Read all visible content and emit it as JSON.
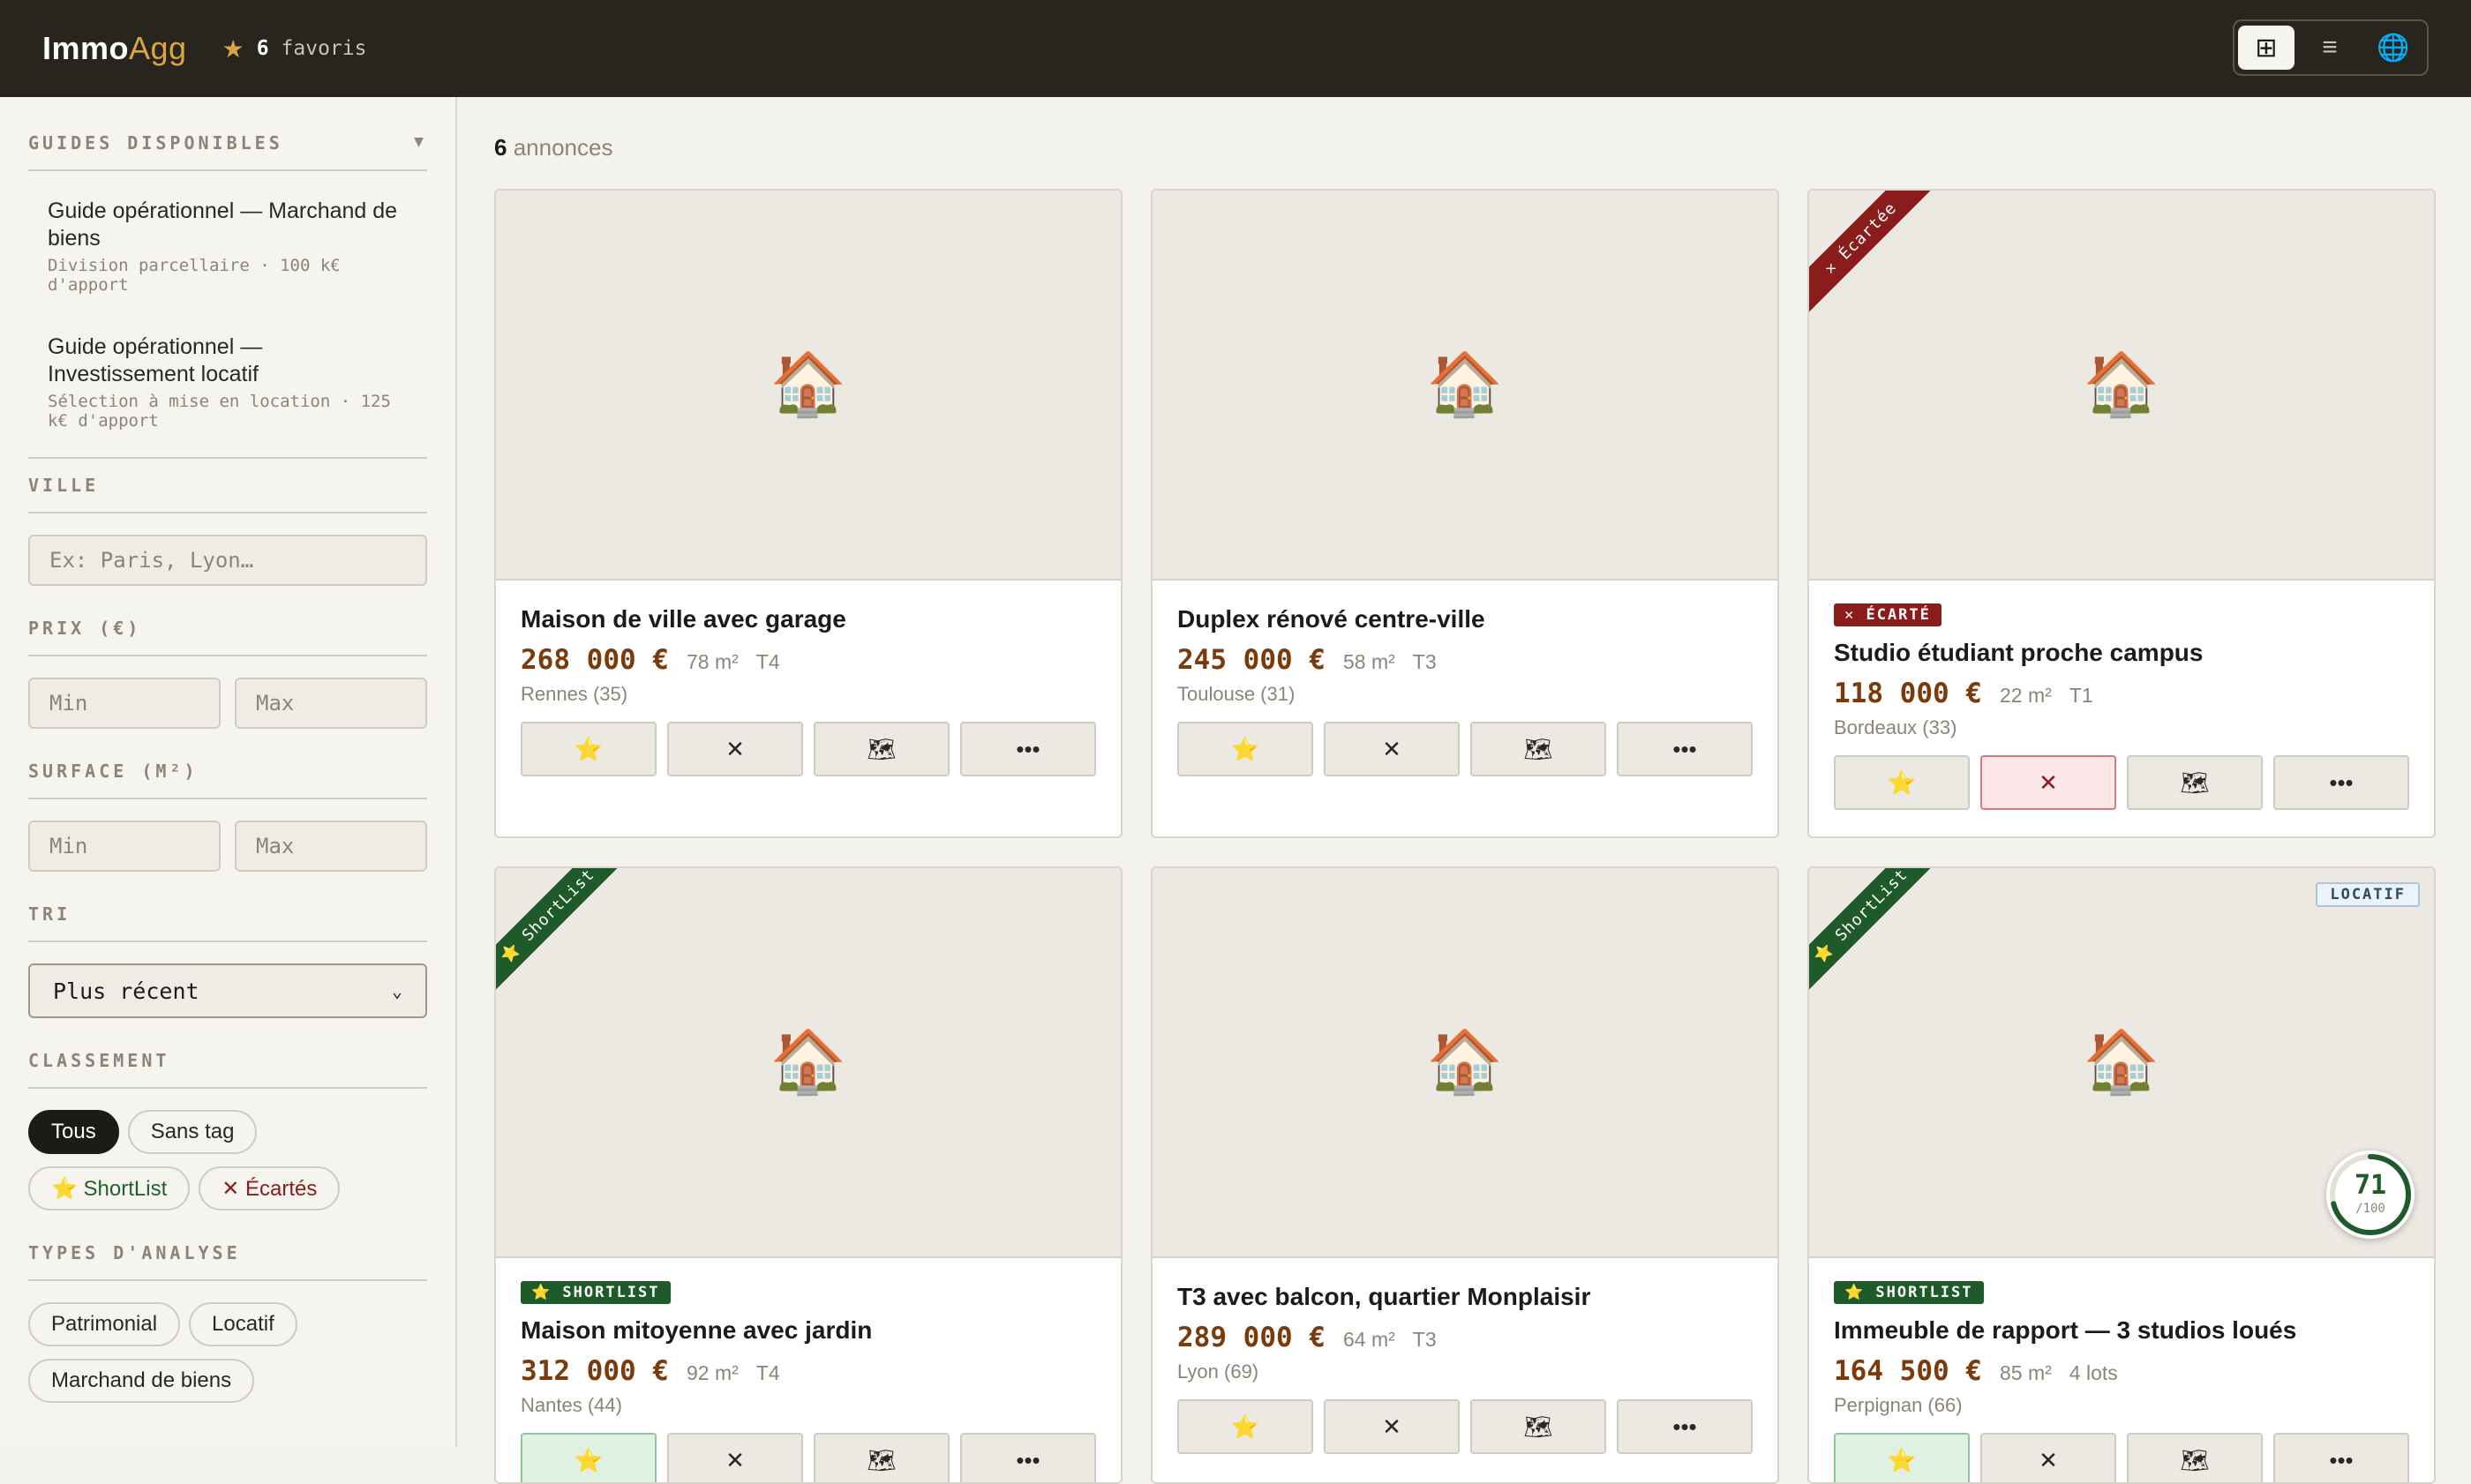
{
  "header": {
    "logo_main": "Immo",
    "logo_accent": "Agg",
    "fav_count": "6",
    "fav_label": "favoris",
    "views": [
      {
        "name": "grid-view-button",
        "glyph": "⊞"
      },
      {
        "name": "list-view-button",
        "glyph": "≡"
      },
      {
        "name": "map-view-button",
        "glyph": "🌐"
      }
    ]
  },
  "sidebar": {
    "guides_title": "GUIDES DISPONIBLES",
    "guides": [
      {
        "title": "Guide opérationnel — Marchand de biens",
        "sub": "Division parcellaire · 100 k€ d'apport"
      },
      {
        "title": "Guide opérationnel — Investissement locatif",
        "sub": "Sélection à mise en location · 125 k€ d'apport"
      }
    ],
    "ville_title": "VILLE",
    "ville_placeholder": "Ex: Paris, Lyon…",
    "prix_title": "PRIX (€)",
    "surface_title": "SURFACE (M²)",
    "min_placeholder": "Min",
    "max_placeholder": "Max",
    "tri_title": "TRI",
    "tri_value": "Plus récent",
    "classement_title": "CLASSEMENT",
    "classement": [
      "Tous",
      "Sans tag",
      "⭐ ShortList",
      "✕ Écartés"
    ],
    "types_title": "TYPES D'ANALYSE",
    "types": [
      "Patrimonial",
      "Locatif",
      "Marchand de biens"
    ]
  },
  "main": {
    "count": "6",
    "count_label": "annonces",
    "house_glyph": "🏠",
    "actions": {
      "star": "⭐",
      "discard": "✕",
      "map": "🗺",
      "more": "•••"
    },
    "listings": [
      {
        "title": "Maison de ville avec garage",
        "price": "268 000 €",
        "surface": "78 m²",
        "rooms": "T4",
        "city": "Rennes (35)",
        "tag": "",
        "ribbon": ""
      },
      {
        "title": "Duplex rénové centre-ville",
        "price": "245 000 €",
        "surface": "58 m²",
        "rooms": "T3",
        "city": "Toulouse (31)",
        "tag": "",
        "ribbon": ""
      },
      {
        "title": "Studio étudiant proche campus",
        "price": "118 000 €",
        "surface": "22 m²",
        "rooms": "T1",
        "city": "Bordeaux (33)",
        "tag": "✕ ÉCARTÉ",
        "ribbon": "✕ Écartée"
      },
      {
        "title": "Maison mitoyenne avec jardin",
        "price": "312 000 €",
        "surface": "92 m²",
        "rooms": "T4",
        "city": "Nantes (44)",
        "tag": "⭐ SHORTLIST",
        "ribbon": "⭐ ShortList"
      },
      {
        "title": "T3 avec balcon, quartier Monplaisir",
        "price": "289 000 €",
        "surface": "64 m²",
        "rooms": "T3",
        "city": "Lyon (69)",
        "tag": "",
        "ribbon": ""
      },
      {
        "title": "Immeuble de rapport — 3 studios loués",
        "price": "164 500 €",
        "surface": "85 m²",
        "rooms": "4 lots",
        "city": "Perpignan (66)",
        "tag": "⭐ SHORTLIST",
        "ribbon": "⭐ ShortList",
        "badge": "LOCATIF",
        "score": "71",
        "score_den": "/100",
        "score_value": 71
      }
    ]
  },
  "colors": {
    "accent": "#d9a441",
    "price": "#7a3a0a",
    "discard": "#8a1c1c",
    "shortlist": "#1f5a2a"
  }
}
